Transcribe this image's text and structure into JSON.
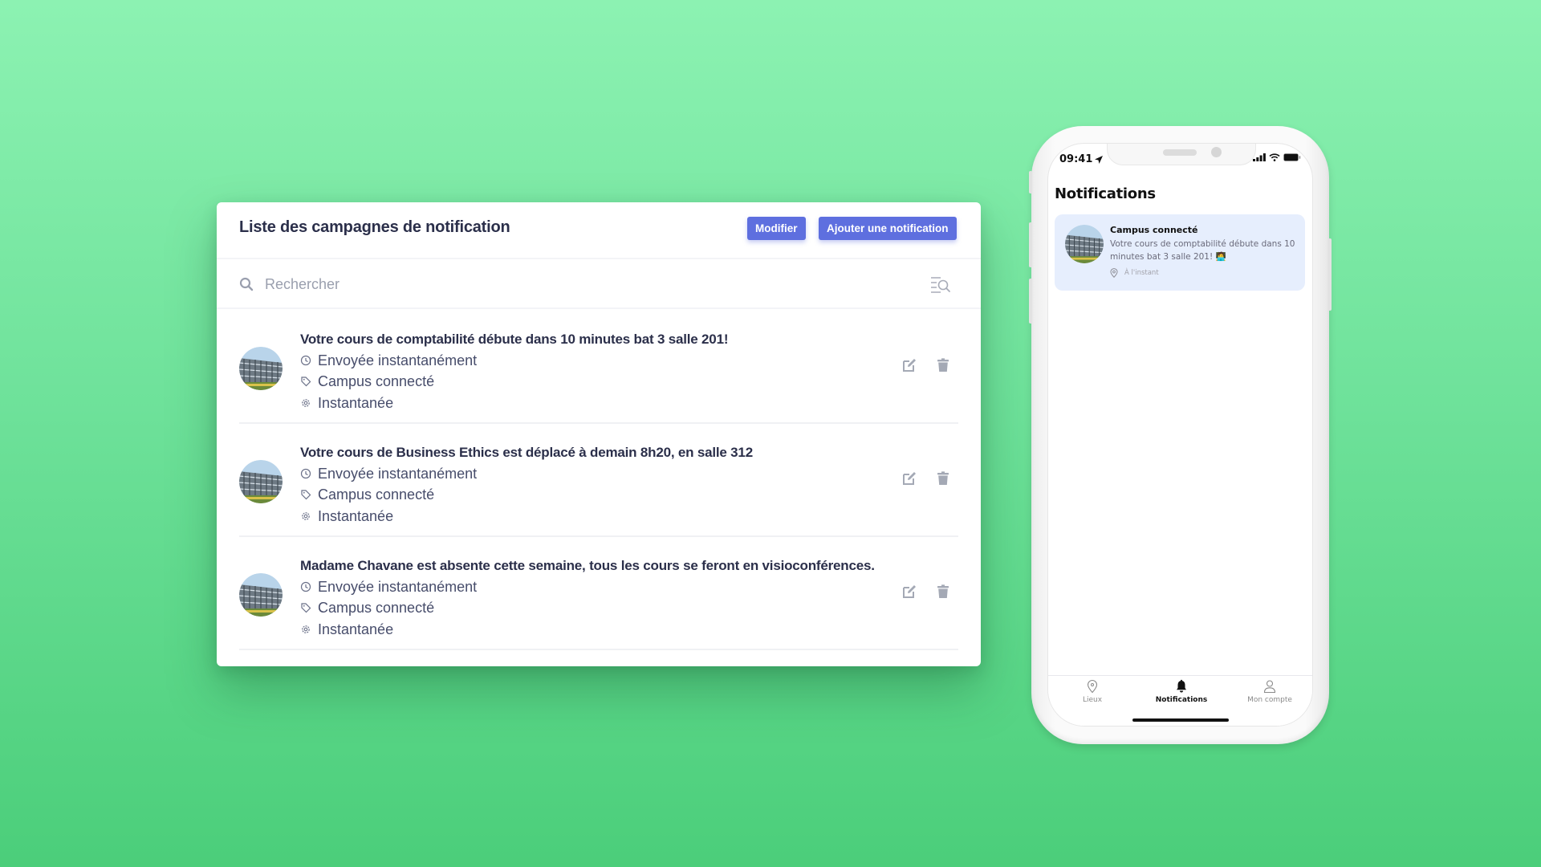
{
  "admin": {
    "title": "Liste des campagnes de notification",
    "buttons": {
      "edit": "Modifier",
      "add": "Ajouter une notification"
    },
    "accent_color": "#5E6FDF",
    "search": {
      "placeholder": "Rechercher",
      "value": ""
    },
    "campaigns": [
      {
        "title": "Votre cours de comptabilité débute dans 10 minutes bat 3 salle 201!",
        "sent": "Envoyée instantanément",
        "tag": "Campus connecté",
        "type": "Instantanée"
      },
      {
        "title": "Votre cours de Business Ethics est déplacé à demain 8h20, en salle 312",
        "sent": "Envoyée instantanément",
        "tag": "Campus connecté",
        "type": "Instantanée"
      },
      {
        "title": "Madame Chavane est absente cette semaine, tous les cours se feront en visioconférences.",
        "sent": "Envoyée instantanément",
        "tag": "Campus connecté",
        "type": "Instantanée"
      }
    ]
  },
  "phone": {
    "status_time": "09:41",
    "screen_title": "Notifications",
    "notification": {
      "title": "Campus connecté",
      "body": "Votre cours de comptabilité débute dans 10 minutes bat 3 salle 201! 🧑‍💻",
      "time": "À l'instant",
      "card_color": "#E6EEFD"
    },
    "tabs": [
      {
        "label": "Lieux",
        "icon": "map-pin-icon",
        "active": false
      },
      {
        "label": "Notifications",
        "icon": "bell-icon",
        "active": true
      },
      {
        "label": "Mon compte",
        "icon": "user-icon",
        "active": false
      }
    ]
  }
}
